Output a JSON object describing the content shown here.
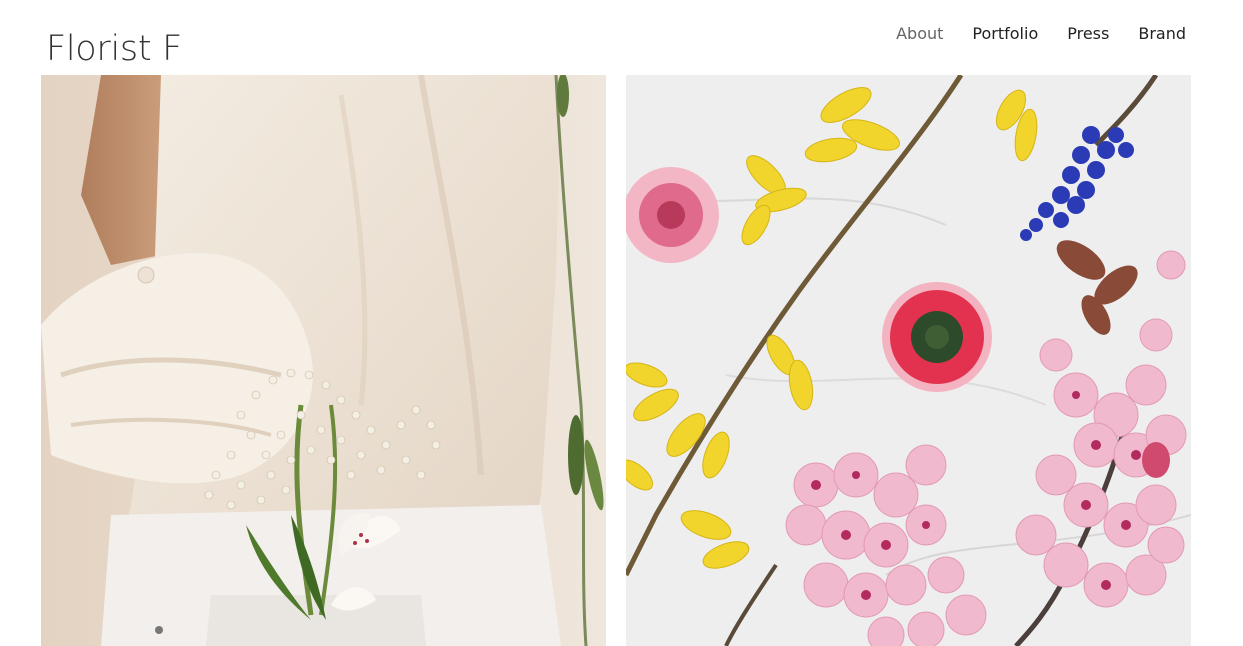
{
  "site": {
    "title": "Florist F"
  },
  "nav": {
    "items": [
      {
        "label": "About",
        "active": true
      },
      {
        "label": "Portfolio",
        "active": false
      },
      {
        "label": "Press",
        "active": false
      },
      {
        "label": "Brand",
        "active": false
      }
    ]
  },
  "gallery": {
    "images": [
      {
        "name": "woman-with-bouquet-in-pocket-photo",
        "subject": "white shirt, gypsophila and alstroemeria in pocket"
      },
      {
        "name": "flat-lay-flowers-on-marble-photo",
        "subject": "forsythia, cherry blossom, gerbera, muscari on marble"
      }
    ]
  },
  "colors": {
    "text": "#333333",
    "nav_active": "#666666",
    "background": "#ffffff"
  }
}
